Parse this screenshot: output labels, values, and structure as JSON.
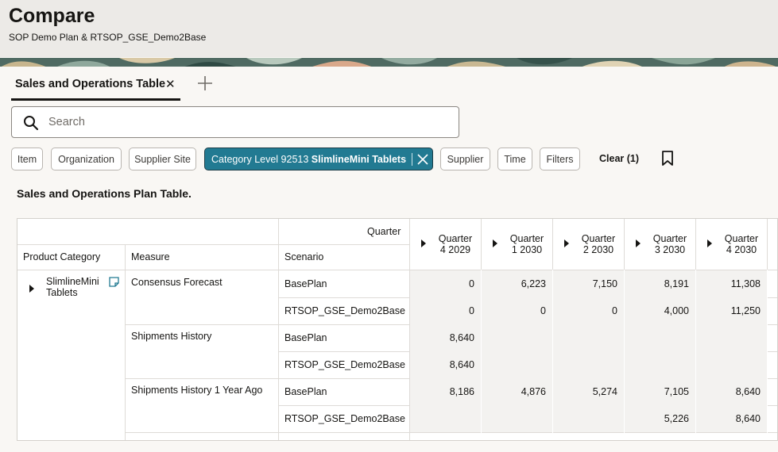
{
  "page": {
    "title": "Compare",
    "subtitle": "SOP Demo Plan & RTSOP_GSE_Demo2Base"
  },
  "tabs": {
    "active_label": "Sales and Operations Table",
    "close_icon": "close-icon",
    "add_icon": "plus-icon"
  },
  "search": {
    "placeholder": "Search",
    "value": "",
    "icon": "search-icon"
  },
  "filters": {
    "chips": [
      "Item",
      "Organization",
      "Supplier Site"
    ],
    "active_chip": {
      "prefix": "Category Level 92513",
      "value": "SlimlineMini Tablets"
    },
    "chips_after": [
      "Supplier",
      "Time",
      "Filters"
    ],
    "clear_label": "Clear (1)",
    "bookmark_icon": "bookmark-icon",
    "accent_color": "#227a92"
  },
  "table": {
    "heading": "Sales and Operations Plan Table.",
    "corner_label": "Quarter",
    "col_headers": {
      "product_category": "Product Category",
      "measure": "Measure",
      "scenario": "Scenario"
    },
    "quarters": [
      {
        "l1": "Quarter",
        "l2": "4 2029"
      },
      {
        "l1": "Quarter",
        "l2": "1 2030"
      },
      {
        "l1": "Quarter",
        "l2": "2 2030"
      },
      {
        "l1": "Quarter",
        "l2": "3 2030"
      },
      {
        "l1": "Quarter",
        "l2": "4 2030"
      }
    ],
    "product": {
      "line1": "SlimlineMini",
      "line2": "Tablets",
      "note_icon": "note-icon"
    },
    "measures": [
      {
        "name": "Consensus Forecast",
        "rows": [
          {
            "scenario": "BasePlan",
            "values": [
              "0",
              "6,223",
              "7,150",
              "8,191",
              "11,308"
            ]
          },
          {
            "scenario": "RTSOP_GSE_Demo2Base",
            "values": [
              "0",
              "0",
              "0",
              "4,000",
              "11,250"
            ]
          }
        ]
      },
      {
        "name": "Shipments History",
        "rows": [
          {
            "scenario": "BasePlan",
            "values": [
              "8,640",
              "",
              "",
              "",
              ""
            ]
          },
          {
            "scenario": "RTSOP_GSE_Demo2Base",
            "values": [
              "8,640",
              "",
              "",
              "",
              ""
            ]
          }
        ]
      },
      {
        "name": "Shipments History 1 Year Ago",
        "rows": [
          {
            "scenario": "BasePlan",
            "values": [
              "8,186",
              "4,876",
              "5,274",
              "7,105",
              "8,640"
            ]
          },
          {
            "scenario": "RTSOP_GSE_Demo2Base",
            "values": [
              "",
              "",
              "",
              "5,226",
              "8,640"
            ]
          }
        ]
      }
    ]
  }
}
